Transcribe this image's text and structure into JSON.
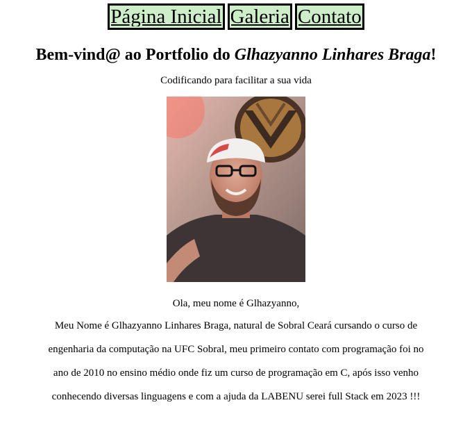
{
  "nav": {
    "items": [
      {
        "label": "Página Inicial"
      },
      {
        "label": "Galeria"
      },
      {
        "label": "Contato"
      }
    ]
  },
  "header": {
    "title_prefix": "Bem-vind@ ao Portfolio do ",
    "title_name": "Glhazyanno Linhares Braga",
    "title_suffix": "!",
    "subtitle": "Codificando para facilitar a sua vida"
  },
  "main": {
    "photo_alt": "Foto de Glhazyanno",
    "greeting": "Ola, meu nome é Glhazyanno,",
    "bio": "Meu Nome é Glhazyanno Linhares Braga, natural de Sobral Ceará cursando o curso de engenharia da computação na UFC Sobral, meu primeiro contato com programação foi no ano de 2010 no ensino médio onde fiz um curso de programação em C, após isso venho conhecendo diversas linguagens e com a ajuda da LABENU serei full Stack em 2023 !!!"
  }
}
